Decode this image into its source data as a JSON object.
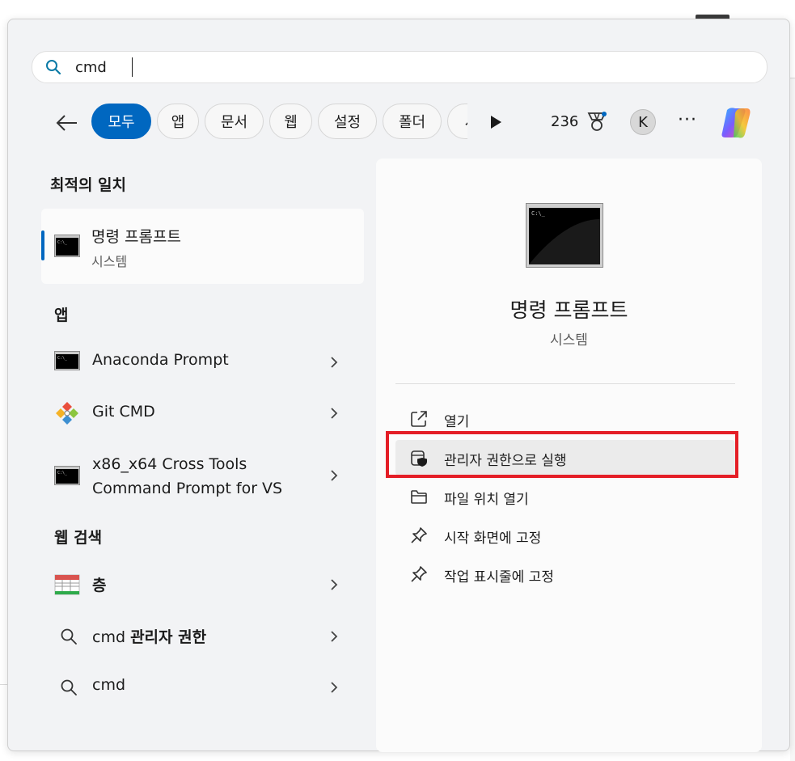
{
  "search": {
    "value": "cmd",
    "placeholder": ""
  },
  "filters": [
    {
      "label": "모두",
      "active": true
    },
    {
      "label": "앱"
    },
    {
      "label": "문서"
    },
    {
      "label": "웹"
    },
    {
      "label": "설정"
    },
    {
      "label": "폴더"
    },
    {
      "label": "사"
    }
  ],
  "toolbar": {
    "points": "236",
    "avatar_initial": "K",
    "more": "···"
  },
  "best_match": {
    "section_title": "최적의 일치",
    "title": "명령 프롬프트",
    "subtitle": "시스템"
  },
  "apps": {
    "section_title": "앱",
    "items": [
      {
        "label": "Anaconda Prompt"
      },
      {
        "label": "Git CMD"
      },
      {
        "label_line1": "x86_x64 Cross Tools",
        "label_line2": "Command Prompt for VS"
      }
    ]
  },
  "web": {
    "section_title": "웹 검색",
    "items": [
      {
        "label": "층"
      },
      {
        "prefix": "cmd ",
        "bold": "관리자 권한"
      },
      {
        "label": "cmd"
      }
    ]
  },
  "detail": {
    "title": "명령 프롬프트",
    "subtitle": "시스템",
    "actions": [
      {
        "label": "열기",
        "icon": "open-external-icon"
      },
      {
        "label": "관리자 권한으로 실행",
        "icon": "shield-icon"
      },
      {
        "label": "파일 위치 열기",
        "icon": "folder-icon"
      },
      {
        "label": "시작 화면에 고정",
        "icon": "pin-icon"
      },
      {
        "label": "작업 표시줄에 고정",
        "icon": "pin-icon"
      }
    ]
  },
  "colors": {
    "accent": "#0067c0",
    "highlight": "#e41e26"
  }
}
